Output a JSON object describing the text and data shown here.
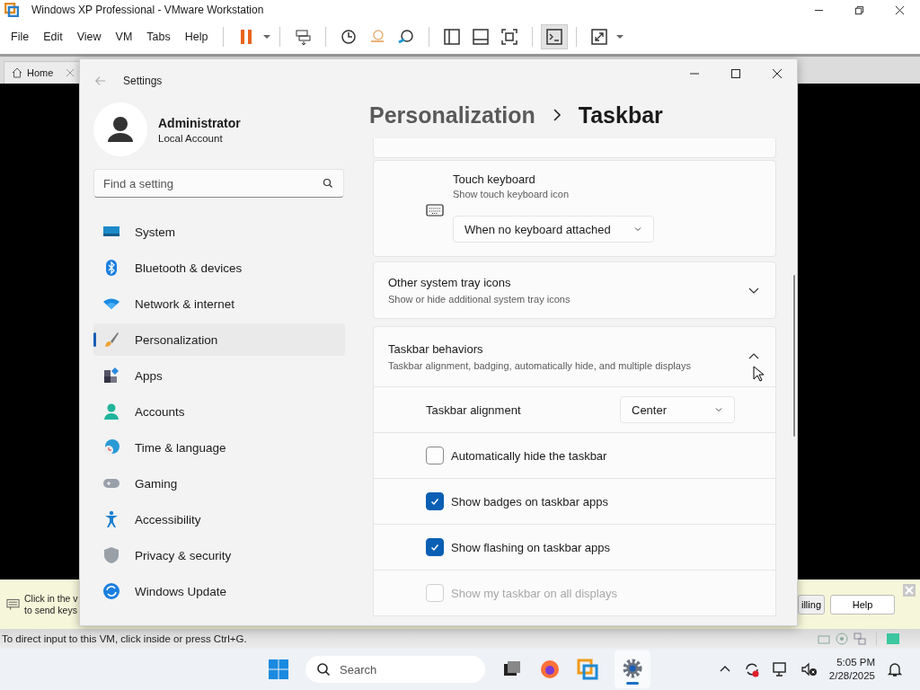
{
  "vmware": {
    "title": "Windows XP Professional - VMware Workstation",
    "menu": [
      "File",
      "Edit",
      "View",
      "VM",
      "Tabs",
      "Help"
    ],
    "tabs": [
      {
        "label": "Home",
        "selected": false
      }
    ],
    "hint": {
      "lines": [
        "Click in the v",
        "to send keys"
      ],
      "buttons": [
        "illing",
        "Help"
      ]
    },
    "status": "To direct input to this VM, click inside or press Ctrl+G."
  },
  "settings": {
    "title": "Settings",
    "user": {
      "name": "Administrator",
      "type": "Local Account"
    },
    "search": {
      "placeholder": "Find a setting"
    },
    "nav": [
      {
        "label": "System",
        "selected": false
      },
      {
        "label": "Bluetooth & devices",
        "selected": false
      },
      {
        "label": "Network & internet",
        "selected": false
      },
      {
        "label": "Personalization",
        "selected": true
      },
      {
        "label": "Apps",
        "selected": false
      },
      {
        "label": "Accounts",
        "selected": false
      },
      {
        "label": "Time & language",
        "selected": false
      },
      {
        "label": "Gaming",
        "selected": false
      },
      {
        "label": "Accessibility",
        "selected": false
      },
      {
        "label": "Privacy & security",
        "selected": false
      },
      {
        "label": "Windows Update",
        "selected": false
      }
    ],
    "breadcrumb": [
      "Personalization",
      "Taskbar"
    ],
    "touch_keyboard": {
      "title": "Touch keyboard",
      "subtitle": "Show touch keyboard icon",
      "value": "When no keyboard attached"
    },
    "sections": [
      {
        "title": "Other system tray icons",
        "subtitle": "Show or hide additional system tray icons",
        "expanded": false
      },
      {
        "title": "Taskbar behaviors",
        "subtitle": "Taskbar alignment, badging, automatically hide, and multiple displays",
        "expanded": true
      }
    ],
    "alignment": {
      "label": "Taskbar alignment",
      "value": "Center"
    },
    "options": [
      {
        "label": "Automatically hide the taskbar",
        "checked": false,
        "disabled": false
      },
      {
        "label": "Show badges on taskbar apps",
        "checked": true,
        "disabled": false
      },
      {
        "label": "Show flashing on taskbar apps",
        "checked": true,
        "disabled": false
      },
      {
        "label": "Show my taskbar on all displays",
        "checked": false,
        "disabled": true
      }
    ]
  },
  "taskbar": {
    "search": {
      "placeholder": "Search"
    },
    "time": "5:05 PM",
    "date": "2/28/2025"
  }
}
